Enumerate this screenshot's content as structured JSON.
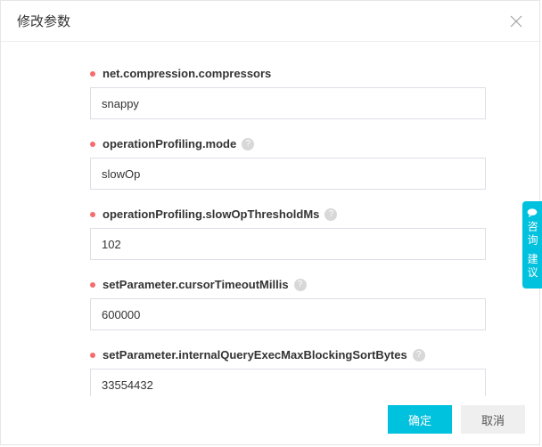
{
  "dialog": {
    "title": "修改参数"
  },
  "fields": [
    {
      "label": "net.compression.compressors",
      "value": "snappy",
      "help": false
    },
    {
      "label": "operationProfiling.mode",
      "value": "slowOp",
      "help": true
    },
    {
      "label": "operationProfiling.slowOpThresholdMs",
      "value": "102",
      "help": true
    },
    {
      "label": "setParameter.cursorTimeoutMillis",
      "value": "600000",
      "help": true
    },
    {
      "label": "setParameter.internalQueryExecMaxBlockingSortBytes",
      "value": "33554432",
      "help": true
    }
  ],
  "footer": {
    "ok": "确定",
    "cancel": "取消"
  },
  "sideTab": {
    "text": "咨询 建议"
  }
}
